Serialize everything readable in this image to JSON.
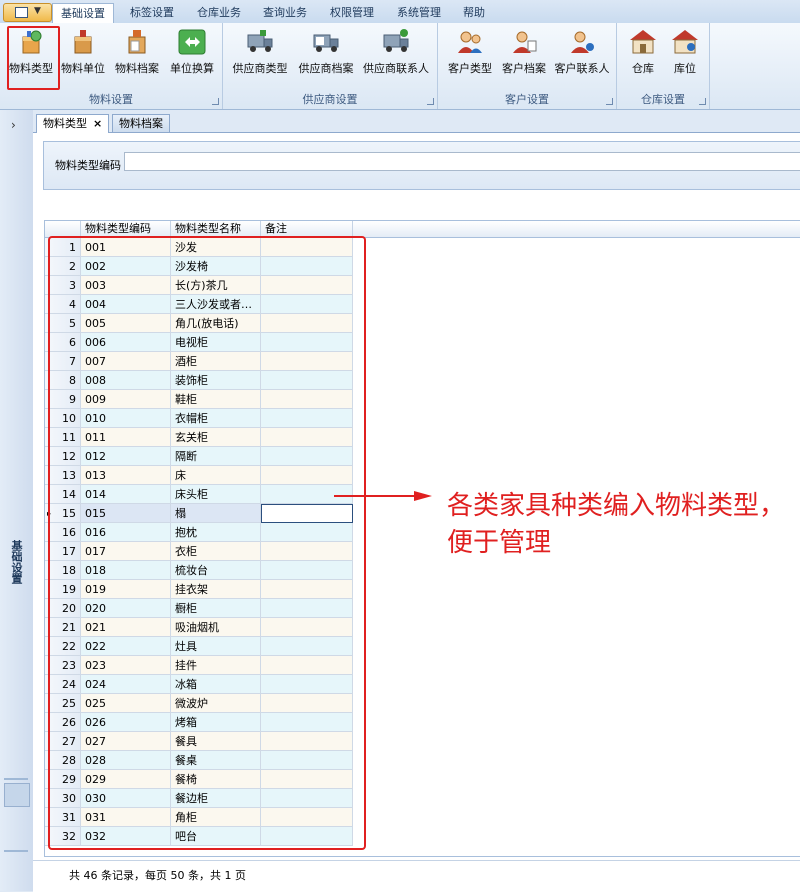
{
  "menu_tabs": [
    "基础设置",
    "标签设置",
    "仓库业务",
    "查询业务",
    "权限管理",
    "系统管理",
    "帮助"
  ],
  "ribbon": {
    "groups": [
      {
        "label": "物料设置",
        "buttons": [
          "物料类型",
          "物料单位",
          "物料档案",
          "单位换算"
        ]
      },
      {
        "label": "供应商设置",
        "buttons": [
          "供应商类型",
          "供应商档案",
          "供应商联系人"
        ]
      },
      {
        "label": "客户设置",
        "buttons": [
          "客户类型",
          "客户档案",
          "客户联系人"
        ]
      },
      {
        "label": "仓库设置",
        "buttons": [
          "仓库",
          "库位"
        ]
      }
    ]
  },
  "left_panel": {
    "title": "基础设置",
    "expand_icon": "chevron-right-icon"
  },
  "doc_tabs": [
    {
      "label": "物料类型",
      "closable": true,
      "active": true
    },
    {
      "label": "物料档案",
      "closable": false,
      "active": false
    }
  ],
  "search": {
    "label": "物料类型编码",
    "value": ""
  },
  "grid": {
    "columns": [
      "物料类型编码",
      "物料类型名称",
      "备注"
    ],
    "rows": [
      {
        "n": "1",
        "code": "001",
        "name": "沙发",
        "note": ""
      },
      {
        "n": "2",
        "code": "002",
        "name": "沙发椅",
        "note": ""
      },
      {
        "n": "3",
        "code": "003",
        "name": "长(方)茶几",
        "note": ""
      },
      {
        "n": "4",
        "code": "004",
        "name": "三人沙发或者…",
        "note": ""
      },
      {
        "n": "5",
        "code": "005",
        "name": "角几(放电话)",
        "note": ""
      },
      {
        "n": "6",
        "code": "006",
        "name": "电视柜",
        "note": ""
      },
      {
        "n": "7",
        "code": "007",
        "name": "酒柜",
        "note": ""
      },
      {
        "n": "8",
        "code": "008",
        "name": "装饰柜",
        "note": ""
      },
      {
        "n": "9",
        "code": "009",
        "name": "鞋柜",
        "note": ""
      },
      {
        "n": "10",
        "code": "010",
        "name": "衣帽柜",
        "note": ""
      },
      {
        "n": "11",
        "code": "011",
        "name": "玄关柜",
        "note": ""
      },
      {
        "n": "12",
        "code": "012",
        "name": "隔断",
        "note": ""
      },
      {
        "n": "13",
        "code": "013",
        "name": "床",
        "note": ""
      },
      {
        "n": "14",
        "code": "014",
        "name": "床头柜",
        "note": ""
      },
      {
        "n": "15",
        "code": "015",
        "name": "榻",
        "note": ""
      },
      {
        "n": "16",
        "code": "016",
        "name": "抱枕",
        "note": ""
      },
      {
        "n": "17",
        "code": "017",
        "name": "衣柜",
        "note": ""
      },
      {
        "n": "18",
        "code": "018",
        "name": "梳妆台",
        "note": ""
      },
      {
        "n": "19",
        "code": "019",
        "name": "挂衣架",
        "note": ""
      },
      {
        "n": "20",
        "code": "020",
        "name": "橱柜",
        "note": ""
      },
      {
        "n": "21",
        "code": "021",
        "name": "吸油烟机",
        "note": ""
      },
      {
        "n": "22",
        "code": "022",
        "name": "灶具",
        "note": ""
      },
      {
        "n": "23",
        "code": "023",
        "name": "挂件",
        "note": ""
      },
      {
        "n": "24",
        "code": "024",
        "name": "冰箱",
        "note": ""
      },
      {
        "n": "25",
        "code": "025",
        "name": "微波炉",
        "note": ""
      },
      {
        "n": "26",
        "code": "026",
        "name": "烤箱",
        "note": ""
      },
      {
        "n": "27",
        "code": "027",
        "name": "餐具",
        "note": ""
      },
      {
        "n": "28",
        "code": "028",
        "name": "餐桌",
        "note": ""
      },
      {
        "n": "29",
        "code": "029",
        "name": "餐椅",
        "note": ""
      },
      {
        "n": "30",
        "code": "030",
        "name": "餐边柜",
        "note": ""
      },
      {
        "n": "31",
        "code": "031",
        "name": "角柜",
        "note": ""
      },
      {
        "n": "32",
        "code": "032",
        "name": "吧台",
        "note": ""
      }
    ],
    "selected_row": "15"
  },
  "status": "共 46 条记录，每页 50 条，共 1 页",
  "annotation": "各类家具种类编入物料类型，便于管理",
  "colors": {
    "highlight": "#e02020",
    "ribbon_bg": "#dbe7f4",
    "row_odd": "#fbf8ef",
    "row_even": "#e6f6fa"
  }
}
